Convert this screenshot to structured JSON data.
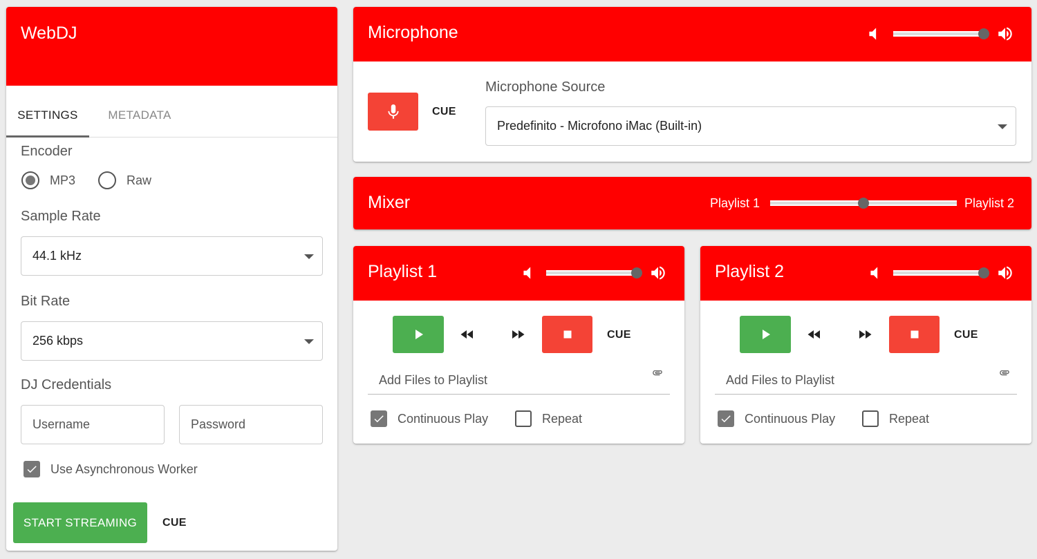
{
  "app": {
    "title": "WebDJ"
  },
  "tabs": [
    {
      "label": "SETTINGS"
    },
    {
      "label": "METADATA"
    }
  ],
  "settings": {
    "encoder_label": "Encoder",
    "encoder_options": [
      {
        "label": "MP3",
        "selected": true
      },
      {
        "label": "Raw",
        "selected": false
      }
    ],
    "samplerate_label": "Sample Rate",
    "samplerate_value": "44.1 kHz",
    "bitrate_label": "Bit Rate",
    "bitrate_value": "256 kbps",
    "credentials_label": "DJ Credentials",
    "username_placeholder": "Username",
    "password_placeholder": "Password",
    "async_worker_label": "Use Asynchronous Worker",
    "async_worker_checked": true,
    "start_label": "START STREAMING",
    "cue_label": "CUE"
  },
  "microphone": {
    "title": "Microphone",
    "volume": 0.96,
    "cue_label": "CUE",
    "source_label": "Microphone Source",
    "source_value": "Predefinito - Microfono iMac (Built-in)"
  },
  "mixer": {
    "title": "Mixer",
    "left_label": "Playlist 1",
    "right_label": "Playlist 2",
    "position": 0.5
  },
  "playlists": [
    {
      "title": "Playlist 1",
      "volume": 0.96,
      "cue_label": "CUE",
      "add_files_label": "Add Files to Playlist",
      "continuous_label": "Continuous Play",
      "continuous_checked": true,
      "repeat_label": "Repeat",
      "repeat_checked": false
    },
    {
      "title": "Playlist 2",
      "volume": 0.96,
      "cue_label": "CUE",
      "add_files_label": "Add Files to Playlist",
      "continuous_label": "Continuous Play",
      "continuous_checked": true,
      "repeat_label": "Repeat",
      "repeat_checked": false
    }
  ],
  "icons": {
    "volume_down": "volume-down-icon",
    "volume_up": "volume-up-icon",
    "microphone": "microphone-icon",
    "play": "play-icon",
    "rewind": "rewind-icon",
    "fast_forward": "fast-forward-icon",
    "stop": "stop-icon",
    "attach": "paperclip-icon",
    "check": "check-icon"
  },
  "colors": {
    "header": "#ff0000",
    "play": "#4caf50",
    "stop": "#f44336",
    "background": "#ececec"
  }
}
